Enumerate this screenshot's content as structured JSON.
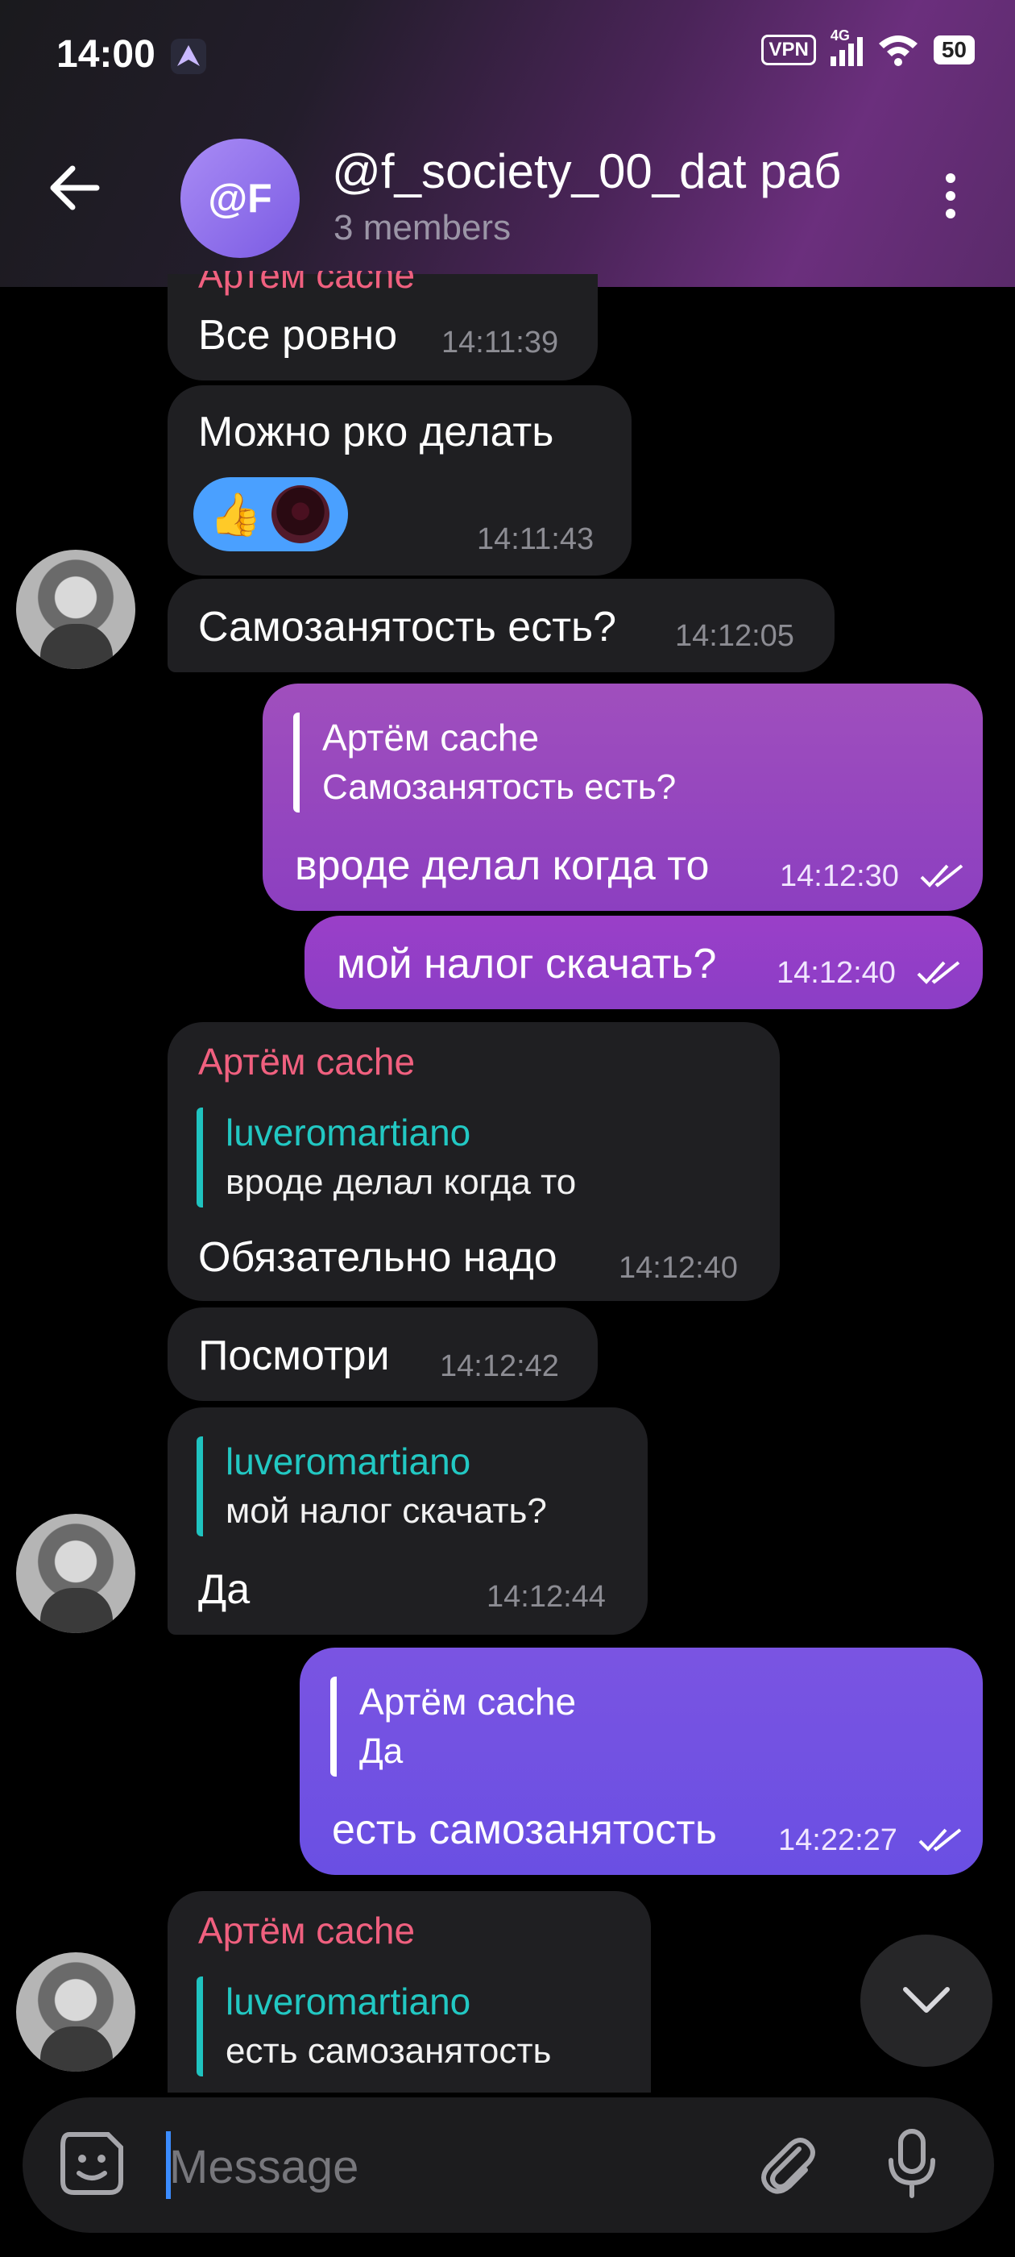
{
  "status": {
    "time": "14:00",
    "vpn": "VPN",
    "network": "4G",
    "battery": "50"
  },
  "header": {
    "avatar_text": "@F",
    "title": "@f_society_00_dat раб",
    "subtitle": "3 members"
  },
  "messages": [
    {
      "text": "Все ровно",
      "time": "14:11:39",
      "name_partial": "Артём cache"
    },
    {
      "text": "Можно рко делать",
      "time": "14:11:43",
      "reactions": [
        "👍",
        "avatar-reaction"
      ]
    },
    {
      "text": "Самозанятость есть?",
      "time": "14:12:05"
    },
    {
      "reply_name": "Артём cache",
      "reply_text": "Самозанятость есть?",
      "text": "вроде делал когда то",
      "time": "14:12:30"
    },
    {
      "text": "мой налог скачать?",
      "time": "14:12:40"
    },
    {
      "name": "Артём cache",
      "reply_name": "luveromartiano",
      "reply_text": "вроде делал когда то",
      "text": "Обязательно надо",
      "time": "14:12:40"
    },
    {
      "text": "Посмотри",
      "time": "14:12:42"
    },
    {
      "reply_name": "luveromartiano",
      "reply_text": "мой налог скачать?",
      "text": "Да",
      "time": "14:12:44"
    },
    {
      "reply_name": "Артём cache",
      "reply_text": "Да",
      "text": "есть самозанятость",
      "time": "14:22:27"
    },
    {
      "name": "Артём cache",
      "reply_name": "luveromartiano",
      "reply_text": "есть самозанятость"
    }
  ],
  "composer": {
    "placeholder": "Message"
  },
  "colors": {
    "accent_name": "#f0607f",
    "reply_bar": "#1fc3c0",
    "outgoing_purple": "#8c3fc0",
    "outgoing_violet": "#6a4fe3"
  }
}
